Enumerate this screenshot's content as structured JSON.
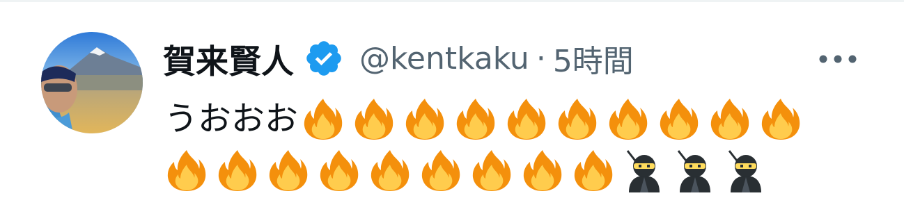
{
  "tweet": {
    "display_name": "賀来賢人",
    "handle": "@kentkaku",
    "separator": "·",
    "time": "5時間",
    "text": "うおおお",
    "emoji_line1": [
      "fire-emoji",
      "fire-emoji",
      "fire-emoji",
      "fire-emoji",
      "fire-emoji",
      "fire-emoji",
      "fire-emoji",
      "fire-emoji",
      "fire-emoji",
      "fire-emoji"
    ],
    "emoji_line2": [
      "fire-emoji",
      "fire-emoji",
      "fire-emoji",
      "fire-emoji",
      "fire-emoji",
      "fire-emoji",
      "fire-emoji",
      "fire-emoji",
      "fire-emoji",
      "ninja-emoji",
      "ninja-emoji",
      "ninja-emoji"
    ]
  },
  "icons": {
    "verified": "verified-badge-icon",
    "more": "more-options-icon"
  },
  "colors": {
    "text_primary": "#0f1419",
    "text_secondary": "#536471",
    "verified_blue": "#1d9bf0",
    "divider": "#eff3f4"
  }
}
